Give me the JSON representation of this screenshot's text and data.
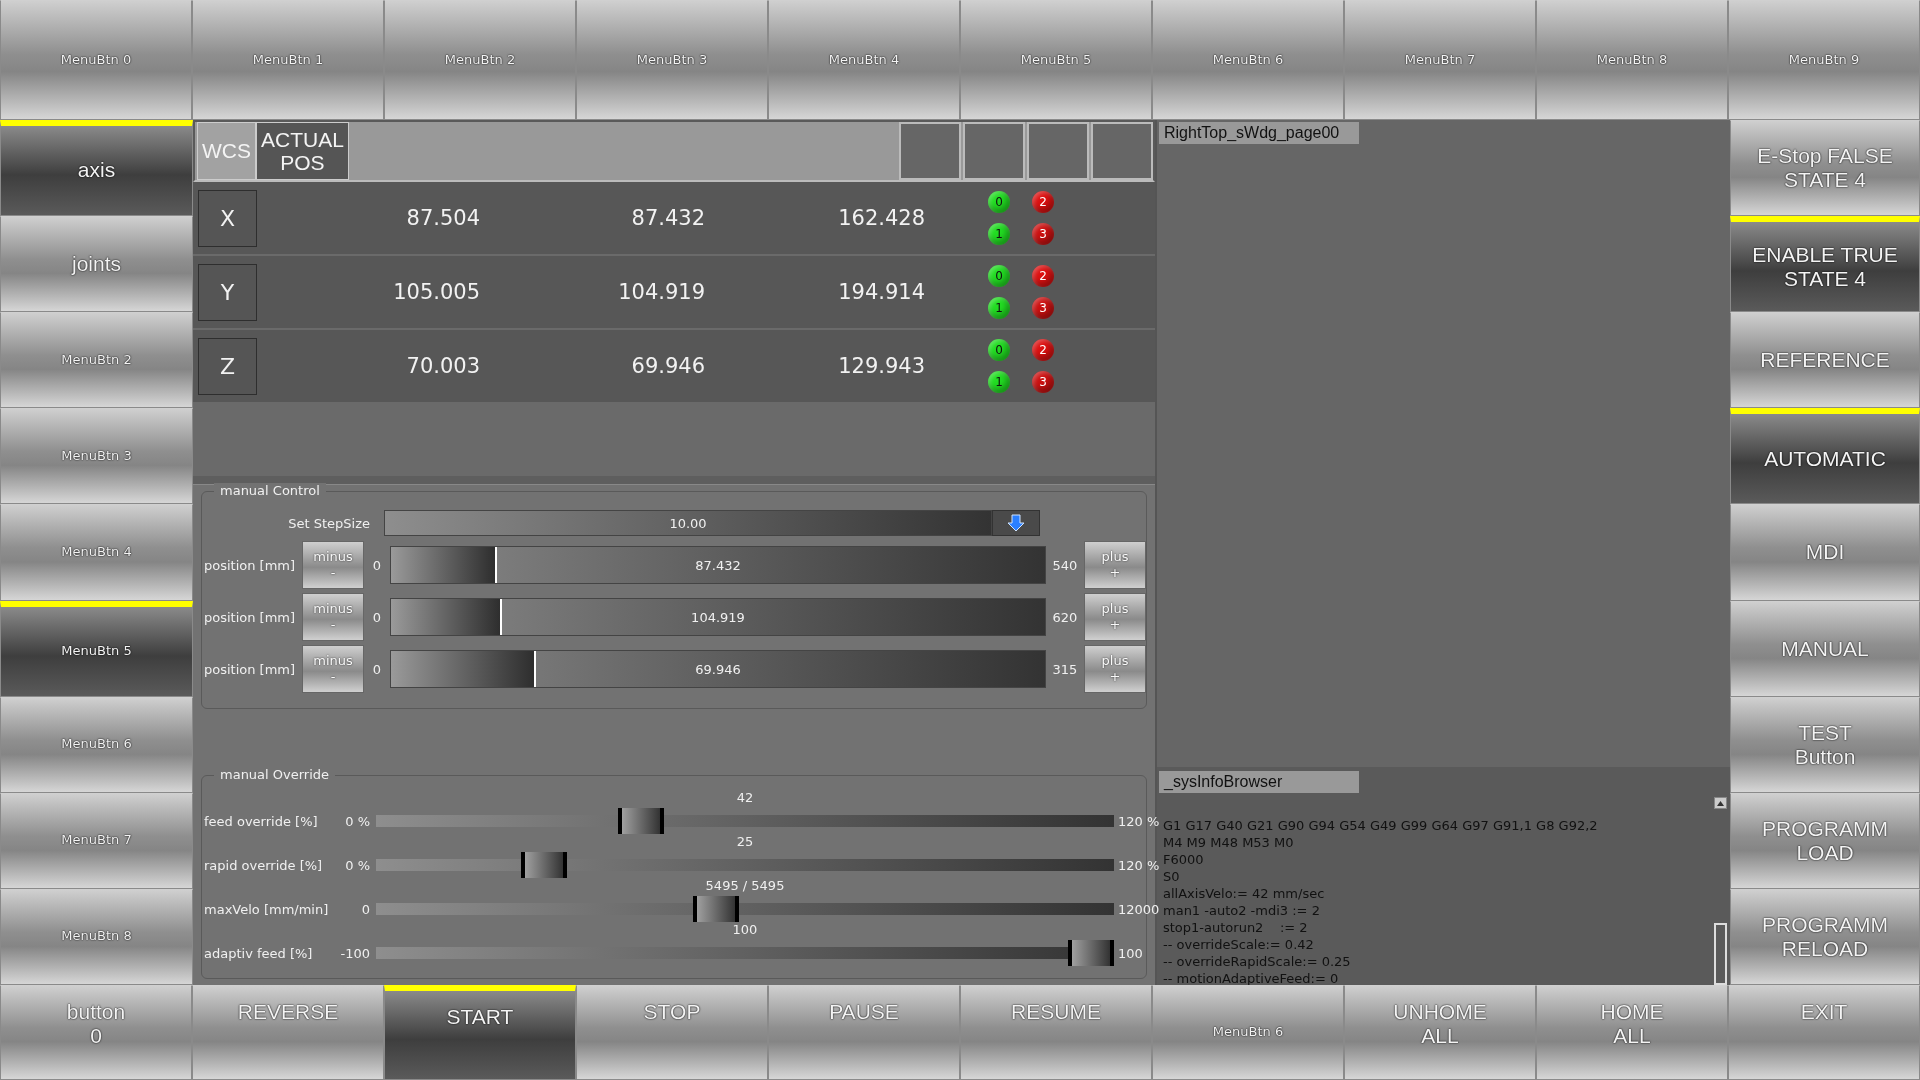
{
  "top_menu": [
    {
      "label": "MenuBtn 0",
      "selected": false
    },
    {
      "label": "MenuBtn 1",
      "selected": false
    },
    {
      "label": "MenuBtn 2",
      "selected": false
    },
    {
      "label": "MenuBtn 3",
      "selected": false
    },
    {
      "label": "MenuBtn 4",
      "selected": false
    },
    {
      "label": "MenuBtn 5",
      "selected": false
    },
    {
      "label": "MenuBtn 6",
      "selected": false
    },
    {
      "label": "MenuBtn 7",
      "selected": false
    },
    {
      "label": "MenuBtn 8",
      "selected": false
    },
    {
      "label": "MenuBtn 9",
      "selected": false
    }
  ],
  "left_menu": [
    {
      "label": "axis",
      "selected": true,
      "kind": "large"
    },
    {
      "label": "joints",
      "selected": false,
      "kind": "large"
    },
    {
      "label": "MenuBtn 2",
      "selected": false,
      "kind": "small"
    },
    {
      "label": "MenuBtn 3",
      "selected": false,
      "kind": "small"
    },
    {
      "label": "MenuBtn 4",
      "selected": false,
      "kind": "small"
    },
    {
      "label": "MenuBtn 5",
      "selected": true,
      "kind": "small"
    },
    {
      "label": "MenuBtn 6",
      "selected": false,
      "kind": "small"
    },
    {
      "label": "MenuBtn 7",
      "selected": false,
      "kind": "small"
    },
    {
      "label": "MenuBtn 8",
      "selected": false,
      "kind": "small"
    }
  ],
  "position_panel": {
    "tabs": [
      {
        "label": "WCS",
        "selected": false
      },
      {
        "label": "ACTUAL\nPOS",
        "selected": true
      }
    ],
    "axes": [
      {
        "name": "X",
        "values": [
          "87.504",
          "87.432",
          "162.428"
        ],
        "leds": [
          {
            "label": "0",
            "color": "#22dd22"
          },
          {
            "label": "1",
            "color": "#22dd22"
          },
          {
            "label": "2",
            "color": "#dd1111"
          },
          {
            "label": "3",
            "color": "#cc1111"
          }
        ]
      },
      {
        "name": "Y",
        "values": [
          "105.005",
          "104.919",
          "194.914"
        ],
        "leds": [
          {
            "label": "0",
            "color": "#22dd22"
          },
          {
            "label": "1",
            "color": "#22dd22"
          },
          {
            "label": "2",
            "color": "#dd1111"
          },
          {
            "label": "3",
            "color": "#cc1111"
          }
        ]
      },
      {
        "name": "Z",
        "values": [
          "70.003",
          "69.946",
          "129.943"
        ],
        "leds": [
          {
            "label": "0",
            "color": "#22dd22"
          },
          {
            "label": "1",
            "color": "#22dd22"
          },
          {
            "label": "2",
            "color": "#dd1111"
          },
          {
            "label": "3",
            "color": "#cc1111"
          }
        ]
      }
    ]
  },
  "manual_control": {
    "title": "manual Control",
    "step_label": "Set StepSize",
    "step_value": "10.00",
    "rows": [
      {
        "label": "position [mm]",
        "minus": "minus\n-",
        "min": "0",
        "value": "87.432",
        "level": 0.162,
        "max": "540",
        "plus": "plus\n+"
      },
      {
        "label": "position [mm]",
        "minus": "minus\n-",
        "min": "0",
        "value": "104.919",
        "level": 0.169,
        "max": "620",
        "plus": "plus\n+"
      },
      {
        "label": "position [mm]",
        "minus": "minus\n-",
        "min": "0",
        "value": "69.946",
        "level": 0.222,
        "max": "315",
        "plus": "plus\n+"
      }
    ]
  },
  "manual_override": {
    "title": "manual Override",
    "rows": [
      {
        "label": "feed override [%]",
        "min": "0 %",
        "value": "42",
        "level": 0.35,
        "max": "120 %"
      },
      {
        "label": "rapid override [%]",
        "min": "0 %",
        "value": "25",
        "level": 0.21,
        "max": "120 %"
      },
      {
        "label": "maxVelo [mm/min]",
        "min": "0",
        "value": "5495 / 5495",
        "level": 0.458,
        "max": "12000"
      },
      {
        "label": "adaptiv feed [%]",
        "min": "-100",
        "value": "100",
        "level": 1.0,
        "max": "100"
      }
    ]
  },
  "right_top": {
    "title": "RightTop_sWdg_page00"
  },
  "sys_info": {
    "title": "_sysInfoBrowser",
    "lines": [
      "G1 G17 G40 G21 G90 G94 G54 G49 G99 G64 G97 G91,1 G8 G92,2",
      "M4 M9 M48 M53 M0",
      "F6000",
      "S0",
      "allAxisVelo:= 42 mm/sec",
      "man1 -auto2 -mdi3 := 2",
      "stop1-autorun2    := 2",
      "-- overrideScale:= 0.42",
      "-- overrideRapidScale:= 0.25",
      "-- motionAdaptiveFeed:= 0"
    ]
  },
  "right_menu": [
    {
      "label": "E-Stop FALSE\nSTATE 4",
      "selected": false
    },
    {
      "label": "ENABLE TRUE\nSTATE 4",
      "selected": true
    },
    {
      "label": "REFERENCE",
      "selected": false
    },
    {
      "label": "AUTOMATIC",
      "selected": true
    },
    {
      "label": "MDI",
      "selected": false
    },
    {
      "label": "MANUAL",
      "selected": false
    },
    {
      "label": "TEST\nButton",
      "selected": false
    },
    {
      "label": "PROGRAMM\nLOAD",
      "selected": false
    },
    {
      "label": "PROGRAMM\nRELOAD",
      "selected": false
    }
  ],
  "bottom_menu": [
    {
      "label": "button\n0",
      "selected": false,
      "kind": "large"
    },
    {
      "label": "REVERSE",
      "selected": false,
      "kind": "large"
    },
    {
      "label": "START",
      "selected": true,
      "kind": "large"
    },
    {
      "label": "STOP",
      "selected": false,
      "kind": "large"
    },
    {
      "label": "PAUSE",
      "selected": false,
      "kind": "large"
    },
    {
      "label": "RESUME",
      "selected": false,
      "kind": "large"
    },
    {
      "label": "MenuBtn 6",
      "selected": false,
      "kind": "small"
    },
    {
      "label": "UNHOME\nALL",
      "selected": false,
      "kind": "large"
    },
    {
      "label": "HOME\nALL",
      "selected": false,
      "kind": "large"
    },
    {
      "label": "EXIT",
      "selected": false,
      "kind": "large"
    }
  ]
}
